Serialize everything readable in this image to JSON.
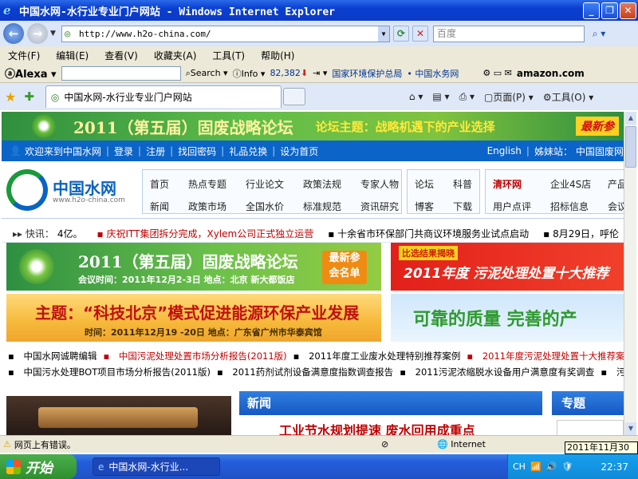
{
  "window": {
    "title": "中国水网-水行业专业门户网站 - Windows Internet Explorer"
  },
  "address": {
    "url": "http://www.h2o-china.com/",
    "search_placeholder": "百度"
  },
  "menu": [
    "文件(F)",
    "编辑(E)",
    "查看(V)",
    "收藏夹(A)",
    "工具(T)",
    "帮助(H)"
  ],
  "alexa": {
    "brand": "Alexa",
    "search_label": "Search",
    "info_label": "Info",
    "rank": "82,382",
    "link1": "国家环境保护总局",
    "link2": "• 中国水务网",
    "amazon": "amazon.com"
  },
  "tabs": {
    "active_title": "中国水网-水行业专业门户网站",
    "page_label": "页面(P)",
    "tools_label": "工具(O)"
  },
  "page": {
    "banner": {
      "title": "2011（第五届）固废战略论坛",
      "theme": "论坛主题：战略机遇下的产业选择",
      "right": "最新参"
    },
    "welcome": {
      "items": [
        "欢迎来到中国水网",
        "登录",
        "注册",
        "找回密码",
        "礼品兑换",
        "设为首页"
      ],
      "english": "English",
      "sister_label": "姊妹站：",
      "sister_site": "中国固废网"
    },
    "logo": {
      "name": "中国水网",
      "site": "www.h2o-china.com"
    },
    "nav_row1": [
      "首页",
      "热点专题",
      "行业论文",
      "政策法规",
      "专家人物"
    ],
    "nav_row2": [
      "新闻",
      "政策市场",
      "全国水价",
      "标准规范",
      "资讯研究"
    ],
    "nav_mid_row1": [
      "论坛",
      "科普"
    ],
    "nav_mid_row2": [
      "博客",
      "下载"
    ],
    "nav_right_row1": [
      "清环网",
      "企业4S店",
      "产品"
    ],
    "nav_right_row2": [
      "用户点评",
      "招标信息",
      "会议"
    ],
    "ticker": {
      "label": "快讯：",
      "items": [
        "4亿。",
        "庆祝ITT集团拆分完成，Xylem公司正式独立运营",
        "十余省市环保部门共商议环境服务业试点启动",
        "8月29日，呼伦"
      ]
    },
    "ad1": {
      "title": "2011（第五届）固废战略论坛",
      "sub": "会议时间：2011年12月2-3日   地点：北京  新大都饭店",
      "badge_line1": "最新参",
      "badge_line2": "会名单"
    },
    "ad2": {
      "tag": "比选结果揭晓",
      "title": "2011年度  污泥处理处置十大推荐"
    },
    "ad3": {
      "title": "主题：“科技北京”模式促进能源环保产业发展",
      "sub": "时间：2011年12月19 -20日    地点：广东省广州市华泰宾馆"
    },
    "ad4": {
      "title": "可靠的质量  完善的产"
    },
    "links_row1": [
      "中国水网诚聘编辑",
      "中国污泥处理处置市场分析报告(2011版)",
      "2011年度工业废水处理特别推荐案例",
      "2011年度污泥处理处置十大推荐案例与"
    ],
    "links_row2": [
      "中国污水处理BOT项目市场分析报告(2011版)",
      "2011药剂试剂设备满意度指数调查报告",
      "2011污泥浓缩脱水设备用户满意度有奖调查",
      "污水处理"
    ],
    "news": {
      "header": "新闻",
      "headline": "工业节水规划提速  废水回用成重点"
    },
    "topic": {
      "header": "专题"
    }
  },
  "status": {
    "message": "网页上有错误。",
    "zone": "Internet",
    "date_tooltip": "2011年11月30日"
  },
  "taskbar": {
    "start": "开始",
    "item": "中国水网-水行业...",
    "lang": "CH",
    "time": "22:37"
  }
}
